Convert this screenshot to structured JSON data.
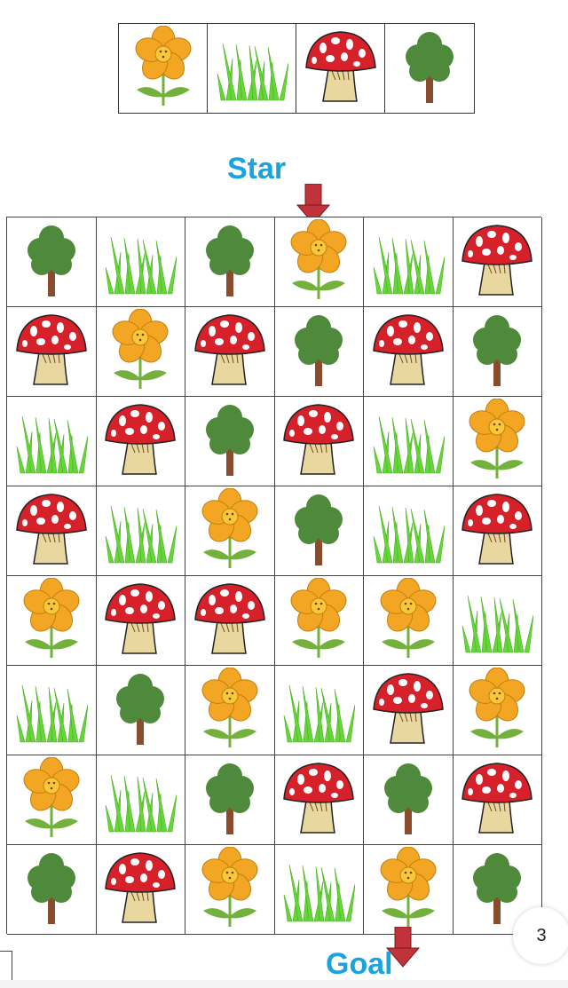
{
  "key_row": [
    "flower",
    "grass",
    "mushroom",
    "tree"
  ],
  "start_label": "Star",
  "goal_label": "Goal",
  "page_number": "3",
  "colors": {
    "label": "#1aa3df",
    "arrow": "#c0333b",
    "grid_line": "#444444",
    "tree_leaf": "#4f8a3c",
    "trunk": "#8b4b2e",
    "grass": "#66d63a",
    "mushroom_cap": "#d6202a",
    "mushroom_stem": "#e9d7a0",
    "flower_petal": "#f2a623",
    "flower_stem": "#73b13c"
  },
  "grid": [
    [
      "tree",
      "grass",
      "tree",
      "flower",
      "grass",
      "mushroom"
    ],
    [
      "mushroom",
      "flower",
      "mushroom",
      "tree",
      "mushroom",
      "tree"
    ],
    [
      "grass",
      "mushroom",
      "tree",
      "mushroom",
      "grass",
      "flower"
    ],
    [
      "mushroom",
      "grass",
      "flower",
      "tree",
      "grass",
      "mushroom"
    ],
    [
      "flower",
      "mushroom",
      "mushroom",
      "flower",
      "flower",
      "grass"
    ],
    [
      "grass",
      "tree",
      "flower",
      "grass",
      "mushroom",
      "flower"
    ],
    [
      "flower",
      "grass",
      "tree",
      "mushroom",
      "tree",
      "mushroom"
    ],
    [
      "tree",
      "mushroom",
      "flower",
      "grass",
      "flower",
      "tree"
    ]
  ]
}
